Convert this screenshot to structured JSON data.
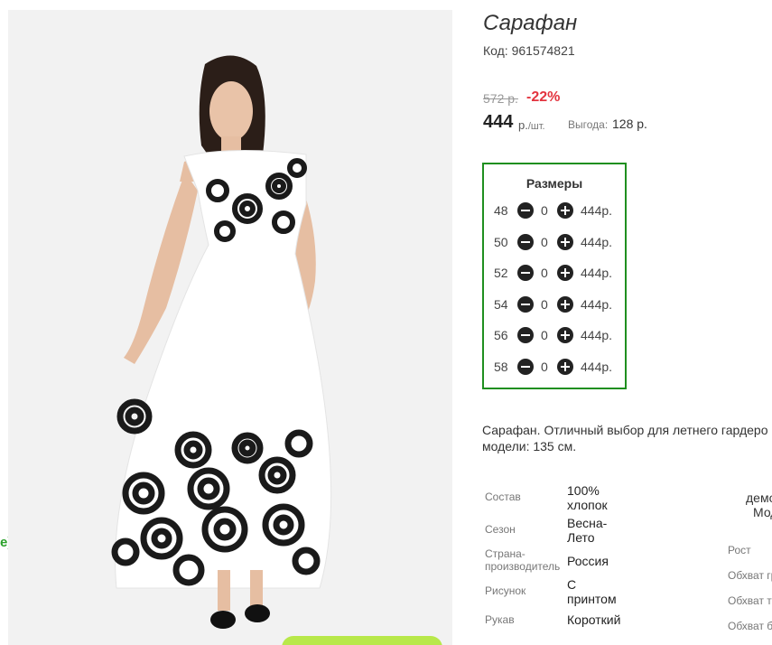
{
  "side_fragment": "e)",
  "product": {
    "title": "Сарафан",
    "code": "Код: 961574821",
    "old_price": "572 р.",
    "discount": "-22%",
    "price": "444",
    "unit_currency": "р.",
    "unit_per": "/шт.",
    "benefit_label": "Выгода:",
    "benefit_value": "128 р."
  },
  "sizes": {
    "title": "Размеры",
    "rows": [
      {
        "size": "48",
        "qty": "0",
        "price": "444р."
      },
      {
        "size": "50",
        "qty": "0",
        "price": "444р."
      },
      {
        "size": "52",
        "qty": "0",
        "price": "444р."
      },
      {
        "size": "54",
        "qty": "0",
        "price": "444р."
      },
      {
        "size": "56",
        "qty": "0",
        "price": "444р."
      },
      {
        "size": "58",
        "qty": "0",
        "price": "444р."
      }
    ]
  },
  "description": {
    "line1": "Сарафан. Отличный выбор для летнего гардеро",
    "line2": "модели: 135 см."
  },
  "specs": [
    {
      "label": "Состав",
      "value": "100% хлопок"
    },
    {
      "label": "Сезон",
      "value": "Весна-Лето"
    },
    {
      "label": "Страна-производитель",
      "value": "Россия"
    },
    {
      "label": "Рисунок",
      "value": "С принтом"
    },
    {
      "label": "Рукав",
      "value": "Короткий"
    }
  ],
  "model": {
    "head1": "демо",
    "head2": "Мод",
    "params": [
      "Рост",
      "Обхват гр",
      "Обхват та",
      "Обхват б"
    ]
  },
  "colors": {
    "accent_green": "#1f8f1f",
    "discount_red": "#e3343f",
    "cart_button": "#b8e84a"
  }
}
